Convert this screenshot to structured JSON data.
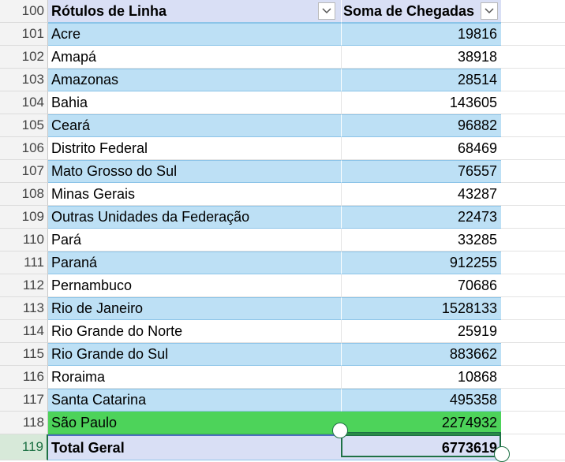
{
  "header": {
    "row_number": "100",
    "row_labels": "Rótulos de Linha",
    "sum_label": "Soma de Chegadas",
    "filter_icon": "chevron-down-icon"
  },
  "rows": [
    {
      "num": "101",
      "label": "Acre",
      "value": "19816"
    },
    {
      "num": "102",
      "label": "Amapá",
      "value": "38918"
    },
    {
      "num": "103",
      "label": "Amazonas",
      "value": "28514"
    },
    {
      "num": "104",
      "label": "Bahia",
      "value": "143605"
    },
    {
      "num": "105",
      "label": "Ceará",
      "value": "96882"
    },
    {
      "num": "106",
      "label": "Distrito Federal",
      "value": "68469"
    },
    {
      "num": "107",
      "label": "Mato Grosso do Sul",
      "value": "76557"
    },
    {
      "num": "108",
      "label": "Minas Gerais",
      "value": "43287"
    },
    {
      "num": "109",
      "label": "Outras Unidades da Federação",
      "value": "22473"
    },
    {
      "num": "110",
      "label": "Pará",
      "value": "33285"
    },
    {
      "num": "111",
      "label": "Paraná",
      "value": "912255"
    },
    {
      "num": "112",
      "label": "Pernambuco",
      "value": "70686"
    },
    {
      "num": "113",
      "label": "Rio de Janeiro",
      "value": "1528133"
    },
    {
      "num": "114",
      "label": "Rio Grande do Norte",
      "value": "25919"
    },
    {
      "num": "115",
      "label": "Rio Grande do Sul",
      "value": "883662"
    },
    {
      "num": "116",
      "label": "Roraima",
      "value": "10868"
    },
    {
      "num": "117",
      "label": "Santa Catarina",
      "value": "495358"
    },
    {
      "num": "118",
      "label": "São Paulo",
      "value": "2274932"
    }
  ],
  "total": {
    "num": "119",
    "label": "Total Geral",
    "value": "6773619"
  },
  "colors": {
    "band_blue": "#bde0f5",
    "header_total": "#d9dff5",
    "highlight_green": "#4dd35a",
    "selection": "#1e7145"
  }
}
